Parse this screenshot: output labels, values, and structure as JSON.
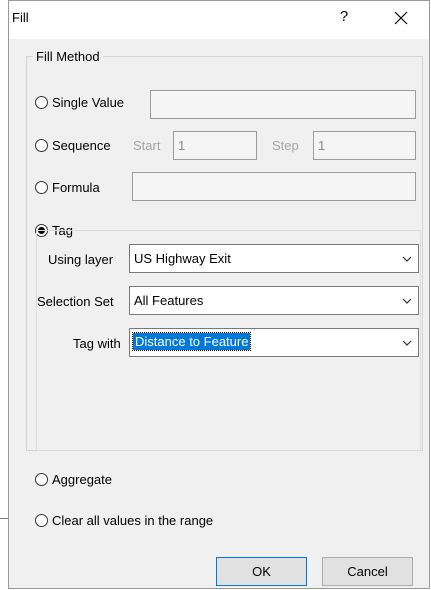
{
  "dialog": {
    "title": "Fill",
    "help_label": "?",
    "close_icon": "close-icon"
  },
  "fill_method": {
    "group_label": "Fill Method",
    "single_value": {
      "label": "Single Value",
      "value": "",
      "selected": false
    },
    "sequence": {
      "label": "Sequence",
      "start_label": "Start",
      "start_value": "1",
      "step_label": "Step",
      "step_value": "1",
      "selected": false
    },
    "formula": {
      "label": "Formula",
      "value": "",
      "selected": false
    },
    "tag": {
      "label": "Tag",
      "selected": true,
      "using_layer_label": "Using layer",
      "using_layer_value": "US Highway Exit",
      "selection_set_label": "Selection Set",
      "selection_set_value": "All Features",
      "tag_with_label": "Tag with",
      "tag_with_value": "Distance to Feature"
    },
    "aggregate": {
      "label": "Aggregate",
      "selected": false
    },
    "clear": {
      "label": "Clear all values in the range",
      "selected": false
    }
  },
  "buttons": {
    "ok": "OK",
    "cancel": "Cancel"
  },
  "colors": {
    "selection_highlight": "#0078d7",
    "dialog_background": "#f0f0f0"
  }
}
